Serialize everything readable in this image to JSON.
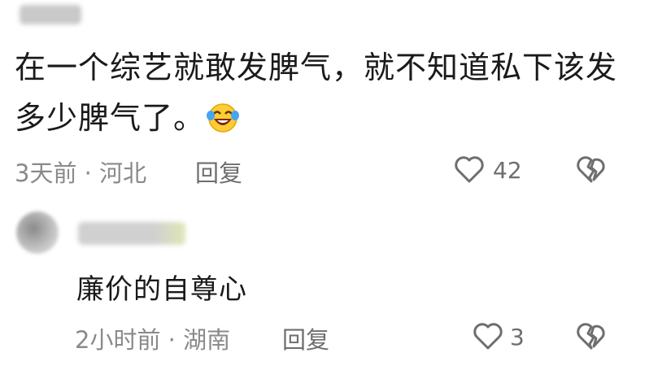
{
  "comment": {
    "text": "在一个综艺就敢发脾气，就不知道私下该发多少脾气了。",
    "emoji": "laughing-crying-emoji",
    "time_location": "3天前 · 河北",
    "reply_label": "回复",
    "likes": "42",
    "colors": {
      "meta": "#8a8a8a",
      "text": "#1a1a1a",
      "icon": "#6e6e6e"
    }
  },
  "reply": {
    "text": "廉价的自尊心",
    "time_location": "2小时前 · 湖南",
    "reply_label": "回复",
    "likes": "3"
  }
}
